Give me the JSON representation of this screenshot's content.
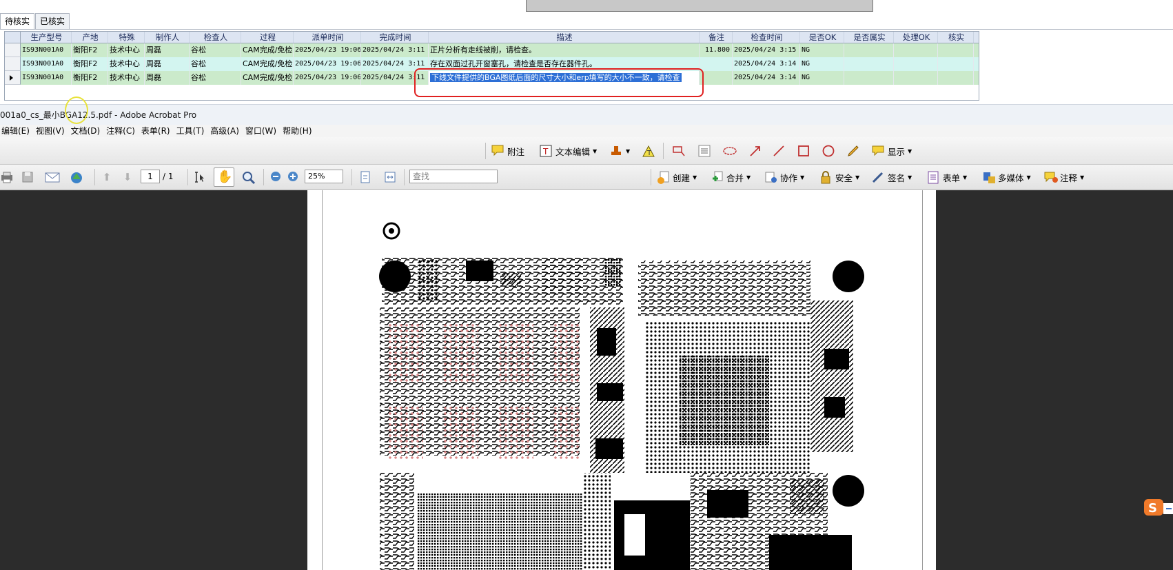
{
  "review": {
    "tabs": [
      "待核实",
      "已核实"
    ],
    "columns": [
      "生产型号",
      "产地",
      "特殊",
      "制作人",
      "检查人",
      "过程",
      "派单时间",
      "完成时间",
      "描述",
      "备注",
      "检查时间",
      "是否OK",
      "是否属实",
      "处理OK",
      "核实"
    ],
    "rows": [
      {
        "model": "IS93N001A0",
        "site": "衡阳F2",
        "special": "技术中心",
        "maker": "周磊",
        "checker": "谷松",
        "process": "CAM完成/免检",
        "dispatch": "2025/04/23 19:06",
        "finish": "2025/04/24 3:11",
        "desc": "正片分析有走线被削，请检查。",
        "note": "11.800",
        "check_time": "2025/04/24 3:15",
        "ok": "NG"
      },
      {
        "model": "IS93N001A0",
        "site": "衡阳F2",
        "special": "技术中心",
        "maker": "周磊",
        "checker": "谷松",
        "process": "CAM完成/免检",
        "dispatch": "2025/04/23 19:06",
        "finish": "2025/04/24 3:11",
        "desc": "存在双面过孔开窗塞孔，请检查是否存在器件孔。",
        "note": "",
        "check_time": "2025/04/24 3:14",
        "ok": "NG"
      },
      {
        "model": "IS93N001A0",
        "site": "衡阳F2",
        "special": "技术中心",
        "maker": "周磊",
        "checker": "谷松",
        "process": "CAM完成/免检",
        "dispatch": "2025/04/23 19:06",
        "finish": "2025/04/24 3:11",
        "desc": "下线文件提供的BGA图纸后面的尺寸大小和erp填写的大小不一致，请检查",
        "note": "",
        "check_time": "2025/04/24 3:14",
        "ok": "NG"
      }
    ]
  },
  "acrobat": {
    "title": "001a0_cs_最小BGA12.5.pdf - Adobe Acrobat Pro",
    "menus": [
      "编辑(E)",
      "视图(V)",
      "文档(D)",
      "注释(C)",
      "表单(R)",
      "工具(T)",
      "高级(A)",
      "窗口(W)",
      "帮助(H)"
    ],
    "toolbar1": {
      "attach": "附注",
      "text_edit": "文本编辑",
      "show": "显示"
    },
    "toolbar2": {
      "page_current": "1",
      "page_total": "/ 1",
      "zoom": "25%",
      "find_placeholder": "查找",
      "create": "创建",
      "merge": "合并",
      "collaborate": "协作",
      "security": "安全",
      "sign": "签名",
      "forms": "表单",
      "multimedia": "多媒体",
      "comment": "注释"
    }
  },
  "colors": {
    "row_green": "#cbeacb",
    "row_cyan": "#d3f5f0",
    "selection": "#2d6fd6",
    "highlight_box": "#e02020",
    "doc_bg": "#2c2c2c"
  }
}
